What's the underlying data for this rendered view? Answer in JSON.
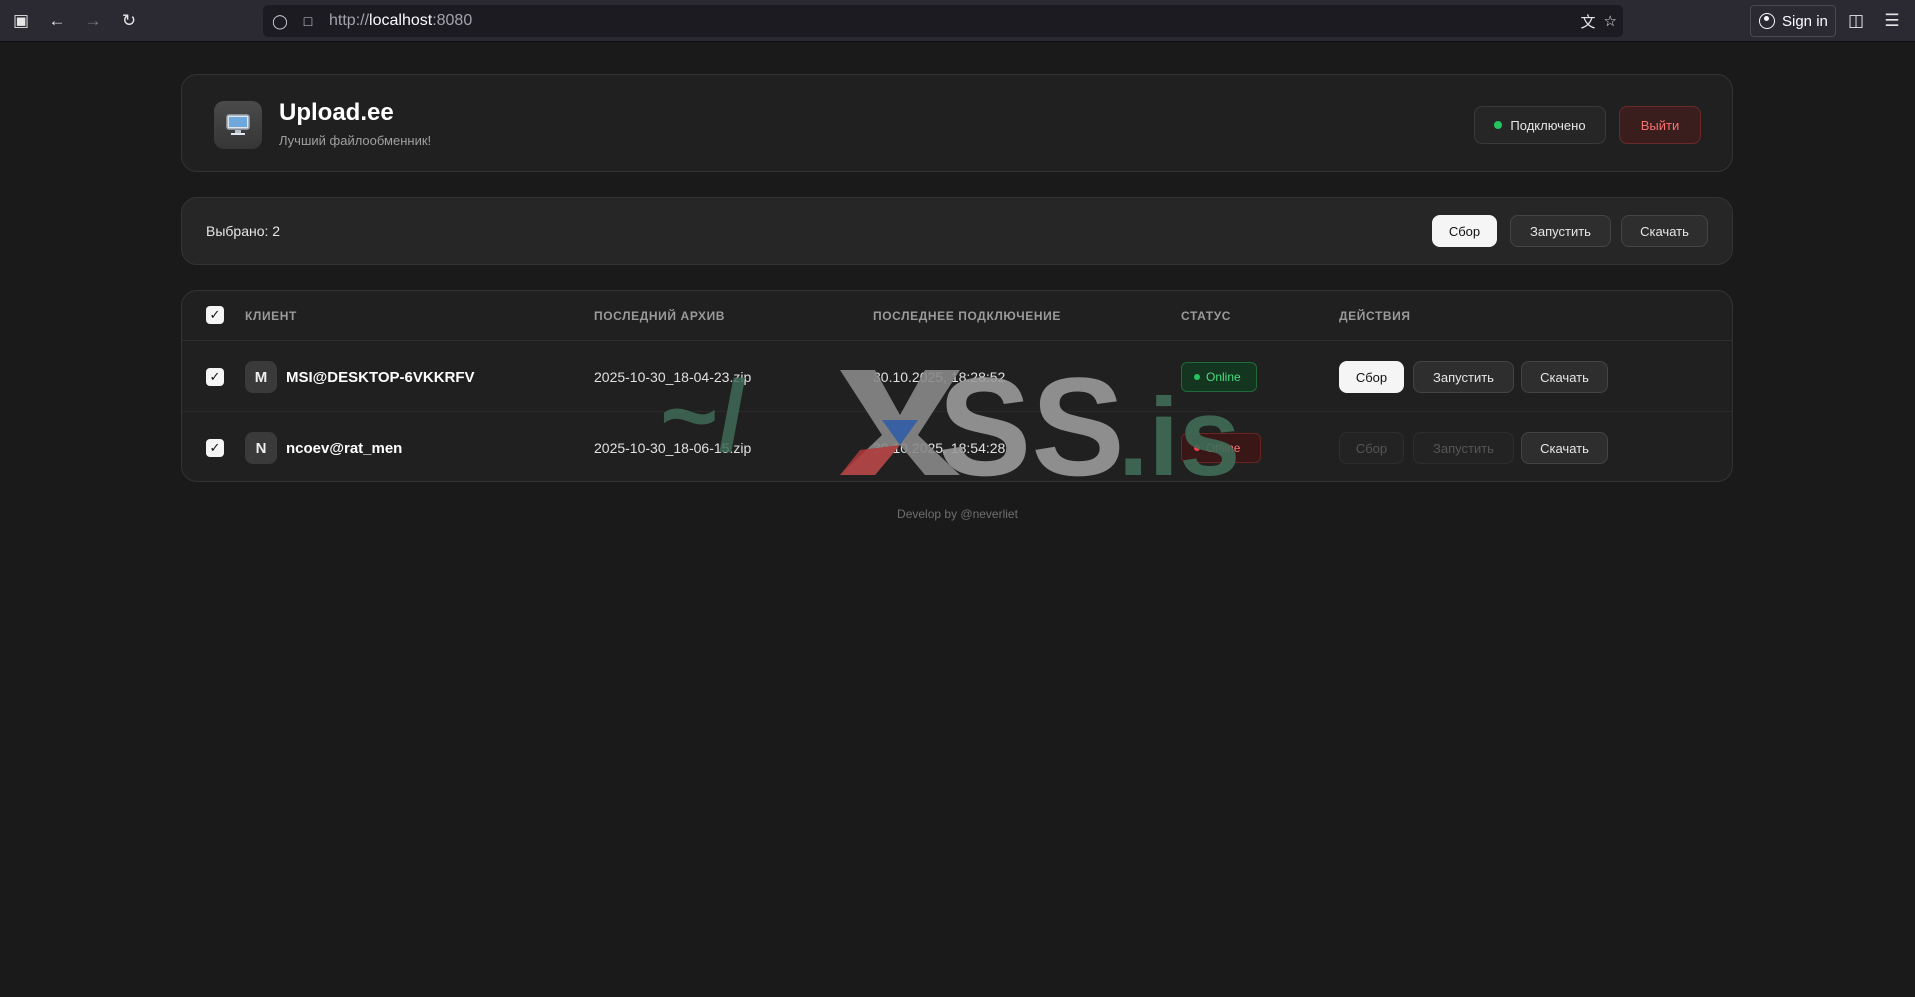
{
  "browser": {
    "url_proto": "http://",
    "url_host": "localhost",
    "url_port": ":8080",
    "signin_label": "Sign in"
  },
  "header": {
    "logo_icon": "monitor-icon",
    "title": "Upload.ee",
    "subtitle": "Лучший файлообменник!",
    "connection_status": "Подключено",
    "logout_label": "Выйти",
    "colors": {
      "connected": "#22c55e",
      "logout": "#f87171"
    }
  },
  "selection": {
    "text": "Выбрано: 2",
    "buttons": {
      "collect": "Сбор",
      "run": "Запустить",
      "download": "Скачать"
    }
  },
  "table": {
    "columns": {
      "client": "КЛИЕНТ",
      "archive": "ПОСЛЕДНИЙ АРХИВ",
      "last_conn": "ПОСЛЕДНЕЕ ПОДКЛЮЧЕНИЕ",
      "status": "СТАТУС",
      "actions": "ДЕЙСТВИЯ"
    },
    "rows": [
      {
        "initial": "M",
        "client": "MSI@DESKTOP-6VKKRFV",
        "archive": "2025-10-30_18-04-23.zip",
        "last_conn": "30.10.2025, 18:28:52",
        "status": "Online",
        "checked": true,
        "actions": {
          "collect": "Сбор",
          "run": "Запустить",
          "download": "Скачать"
        }
      },
      {
        "initial": "N",
        "client": "ncoev@rat_men",
        "archive": "2025-10-30_18-06-15.zip",
        "last_conn": "30.10.2025, 18:54:28",
        "status": "Offline",
        "checked": true,
        "actions": {
          "collect": "Сбор",
          "run": "Запустить",
          "download": "Скачать"
        }
      }
    ]
  },
  "footer": {
    "text": "Develop by @neverliet"
  },
  "watermark": {
    "text_main": "SS",
    "text_domain": ".is",
    "text_prefix": "~/"
  }
}
